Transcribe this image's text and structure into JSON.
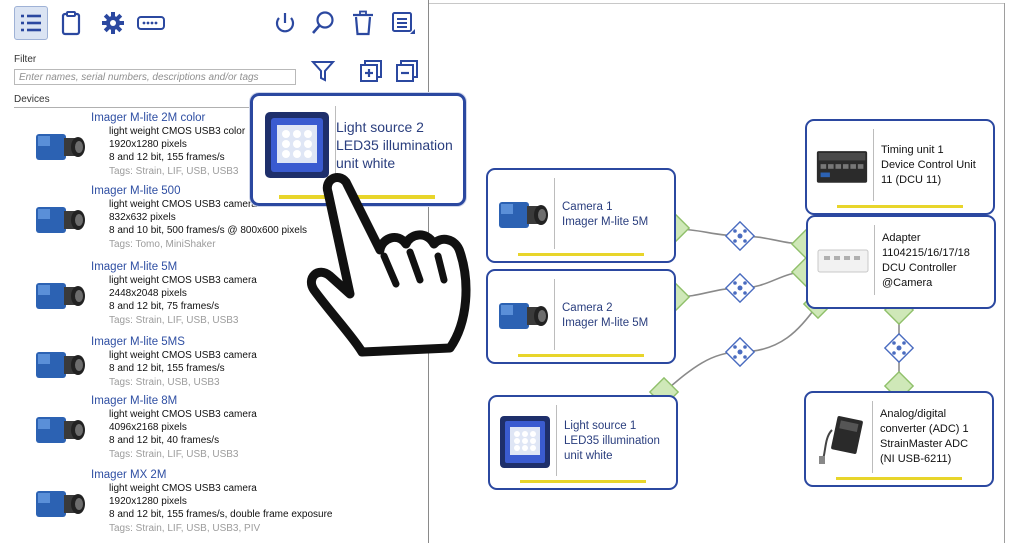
{
  "toolbar": {
    "buttons": [
      {
        "name": "device-list-icon",
        "selected": true
      },
      {
        "name": "clipboard-icon",
        "selected": false
      },
      {
        "name": "gear-icon",
        "selected": false
      },
      {
        "name": "connector-icon",
        "selected": false
      },
      {
        "name": "power-icon",
        "selected": false
      },
      {
        "name": "search-icon",
        "selected": false
      },
      {
        "name": "trash-icon",
        "selected": false
      },
      {
        "name": "panel-menu-icon",
        "selected": false
      }
    ]
  },
  "filter": {
    "label": "Filter",
    "placeholder": "Enter names, serial numbers, descriptions and/or tags"
  },
  "devices": {
    "label": "Devices",
    "items": [
      {
        "title": "Imager M-lite 2M color",
        "lines": [
          "light weight CMOS USB3 color",
          "1920x1280 pixels",
          "8 and 12 bit, 155 frames/s"
        ],
        "tags": "Tags: Strain, LIF, USB, USB3"
      },
      {
        "title": "Imager M-lite 500",
        "lines": [
          "light weight CMOS USB3 camera",
          "832x632 pixels",
          "8 and 10 bit, 500 frames/s @ 800x600 pixels"
        ],
        "tags": "Tags: Tomo, MiniShaker"
      },
      {
        "title": "Imager M-lite 5M",
        "lines": [
          "light weight CMOS USB3 camera",
          "2448x2048 pixels",
          "8 and 12 bit, 75 frames/s"
        ],
        "tags": "Tags: Strain, LIF, USB, USB3"
      },
      {
        "title": "Imager M-lite 5MS",
        "lines": [
          "light weight CMOS USB3 camera",
          "8 and 12 bit, 155 frames/s"
        ],
        "tags": "Tags: Strain, USB, USB3"
      },
      {
        "title": "Imager M-lite 8M",
        "lines": [
          "light weight CMOS USB3 camera",
          "4096x2168 pixels",
          "8 and 12 bit, 40 frames/s"
        ],
        "tags": "Tags: Strain, LIF, USB, USB3"
      },
      {
        "title": "Imager MX 2M",
        "lines": [
          "light weight CMOS USB3 camera",
          "1920x1280 pixels",
          "8 and 12 bit, 155 frames/s, double frame exposure"
        ],
        "tags": "Tags: Strain, LIF, USB, USB3, PIV"
      }
    ]
  },
  "popup": {
    "lines": [
      "Light source 2",
      "LED35 illumination",
      "unit white"
    ]
  },
  "nodes": {
    "camera1": {
      "lines": [
        "Camera 1",
        "Imager M-lite 5M"
      ]
    },
    "camera2": {
      "lines": [
        "Camera 2",
        "Imager M-lite 5M"
      ]
    },
    "light1": {
      "lines": [
        "Light source 1",
        "LED35 illumination",
        "unit white"
      ]
    },
    "timing": {
      "lines": [
        "Timing unit 1",
        "Device Control Unit",
        "11 (DCU 11)"
      ]
    },
    "adapter": {
      "lines": [
        "Adapter",
        "1104215/16/17/18",
        "DCU Controller",
        "@Camera"
      ]
    },
    "adc": {
      "lines": [
        "Analog/digital",
        "converter (ADC) 1",
        "StrainMaster ADC",
        "(NI USB-6211)"
      ]
    }
  },
  "colors": {
    "accent": "#2b48a0",
    "link_text": "#2f4fa3",
    "connector": "#a9d48a",
    "hub": "#4a6cc0",
    "status_bar": "#e8d52a"
  }
}
